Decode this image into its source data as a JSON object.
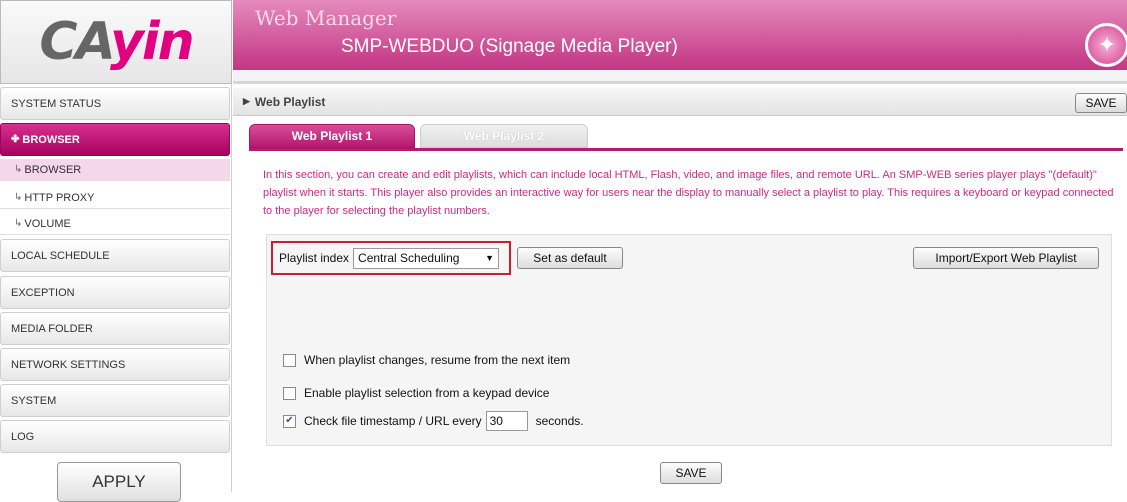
{
  "brand": {
    "logo_prefix": "CA",
    "logo_accent": "yin",
    "accent_color": "#c9448e"
  },
  "header": {
    "title": "Web Manager",
    "subtitle": "SMP-WEBDUO (Signage Media Player)",
    "icon": "magic-wand-icon"
  },
  "sidebar": {
    "items": [
      {
        "label": "SYSTEM STATUS"
      },
      {
        "label": "BROWSER",
        "active": true
      },
      {
        "label": "LOCAL SCHEDULE"
      },
      {
        "label": "EXCEPTION"
      },
      {
        "label": "MEDIA FOLDER"
      },
      {
        "label": "NETWORK SETTINGS"
      },
      {
        "label": "SYSTEM"
      },
      {
        "label": "LOG"
      }
    ],
    "subitems": [
      {
        "label": "BROWSER",
        "active": true
      },
      {
        "label": "HTTP PROXY"
      },
      {
        "label": "VOLUME"
      }
    ],
    "apply_label": "APPLY"
  },
  "page": {
    "breadcrumb": "Web Playlist",
    "save_label": "SAVE",
    "tabs": [
      {
        "label": "Web Playlist 1",
        "active": true
      },
      {
        "label": "Web Playlist 2",
        "active": false
      }
    ],
    "description": "In this section, you can create and edit playlists, which can include local HTML, Flash, video, and image files, and remote URL. An SMP-WEB series player plays \"(default)\" playlist when it starts. This player also provides an interactive way for users near the display to manually select a playlist to play. This requires a keyboard or keypad connected to the player for selecting the playlist numbers.",
    "playlist_index_label": "Playlist index",
    "playlist_index_value": "Central Scheduling",
    "set_default_label": "Set as default",
    "import_export_label": "Import/Export Web Playlist",
    "options": [
      {
        "label": "When playlist changes, resume from the next item",
        "checked": false
      },
      {
        "label": "Enable playlist selection from a keypad device",
        "checked": false
      }
    ],
    "timestamp_prefix": "Check file timestamp / URL every",
    "timestamp_value": "30",
    "timestamp_suffix": "seconds.",
    "timestamp_checked": true,
    "bottom_save_label": "SAVE"
  }
}
